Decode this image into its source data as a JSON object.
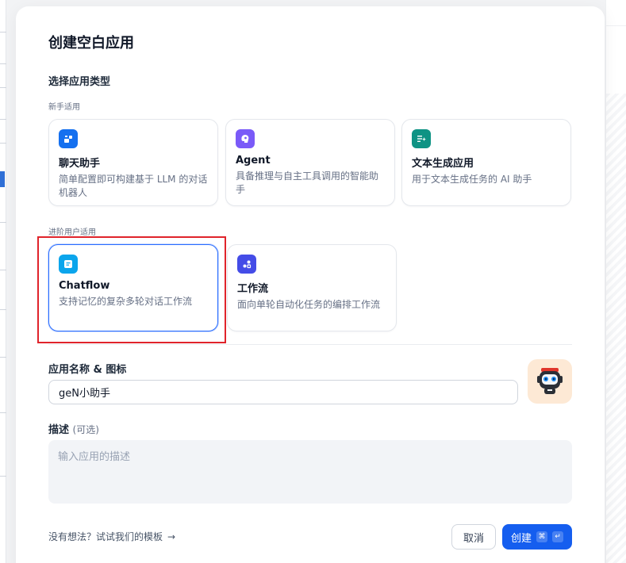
{
  "modal": {
    "title": "创建空白应用",
    "section_label": "选择应用类型",
    "beginner_label": "新手适用",
    "advanced_label": "进阶用户适用",
    "beginner_cards": [
      {
        "title": "聊天助手",
        "desc": "简单配置即可构建基于 LLM 的对话机器人",
        "icon": "chat-bot-icon",
        "color": "#1570ef"
      },
      {
        "title": "Agent",
        "desc": "具备推理与自主工具调用的智能助手",
        "icon": "agent-brain-icon",
        "color": "#7a5af8"
      },
      {
        "title": "文本生成应用",
        "desc": "用于文本生成任务的 AI 助手",
        "icon": "text-generation-icon",
        "color": "#0e9384"
      }
    ],
    "advanced_cards": [
      {
        "title": "Chatflow",
        "desc": "支持记忆的复杂多轮对话工作流",
        "icon": "chatflow-icon",
        "color": "#0ba5ec",
        "selected": true
      },
      {
        "title": "工作流",
        "desc": "面向单轮自动化任务的编排工作流",
        "icon": "workflow-icon",
        "color": "#444ce7",
        "selected": false
      }
    ],
    "name_label": "应用名称 & 图标",
    "name_value": "geN小助手",
    "avatar_icon": "robot-avatar-icon",
    "desc_label": "描述",
    "desc_optional": "(可选)",
    "desc_placeholder": "输入应用的描述",
    "template_link": "没有想法？试试我们的模板",
    "template_arrow": "→",
    "cancel_label": "取消",
    "create_label": "创建",
    "create_kbd_1": "⌘",
    "create_kbd_2": "↵"
  }
}
